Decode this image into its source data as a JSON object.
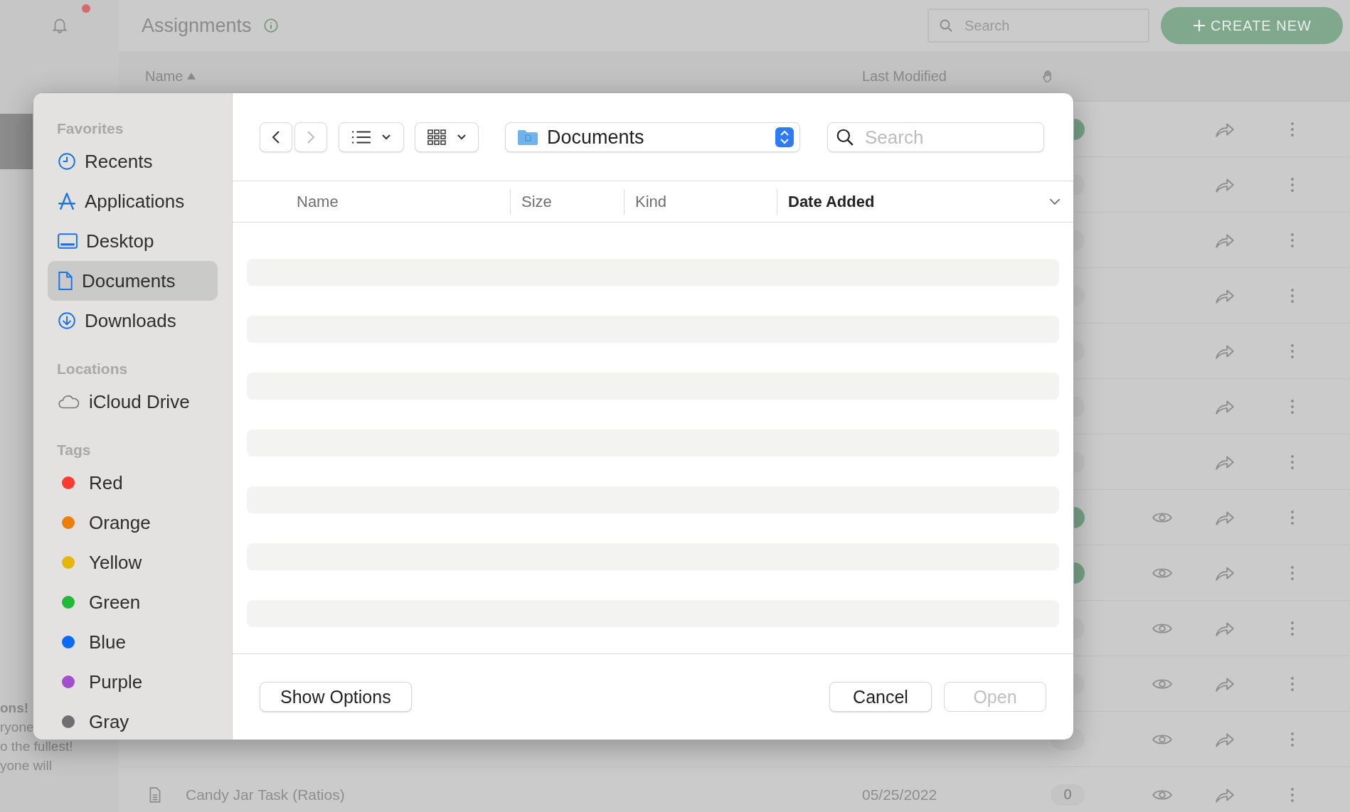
{
  "app": {
    "title": "Assignments",
    "search": {
      "placeholder": "Search"
    },
    "create_button": "CREATE NEW",
    "rail_text": [
      {
        "text": "ons!",
        "bold": true
      },
      {
        "text": "ryone",
        "bold": false
      },
      {
        "text": "o the fullest!",
        "bold": false
      },
      {
        "text": "yone will",
        "bold": false
      }
    ],
    "columns": [
      {
        "label": "Name",
        "sorted": true
      },
      {
        "label": "Last Modified",
        "sorted": false
      }
    ],
    "rows": [
      {
        "color": "#78a287",
        "viewable": false
      },
      {
        "color": "#c4c4c4",
        "viewable": false
      },
      {
        "color": "#c4c4c4",
        "viewable": false
      },
      {
        "color": "#c4c4c4",
        "viewable": false
      },
      {
        "color": "#c4c4c4",
        "viewable": false
      },
      {
        "color": "#c4c4c4",
        "viewable": false
      },
      {
        "color": "#c4c4c4",
        "viewable": false
      },
      {
        "color": "#78a287",
        "viewable": true
      },
      {
        "color": "#78a287",
        "viewable": true
      },
      {
        "color": "#c4c4c4",
        "viewable": true
      },
      {
        "color": "#c4c4c4",
        "viewable": true
      },
      {
        "color": "#c4c4c4",
        "viewable": true
      },
      {
        "color": "#c4c4c4",
        "viewable": true,
        "name": "Candy Jar Task (Ratios)",
        "date": "05/25/2022",
        "count": "0"
      }
    ]
  },
  "dialog": {
    "sidebar": [
      {
        "heading": "Favorites",
        "items": [
          {
            "label": "Recents",
            "selected": false
          },
          {
            "label": "Applications",
            "selected": false
          },
          {
            "label": "Desktop",
            "selected": false
          },
          {
            "label": "Documents",
            "selected": true
          },
          {
            "label": "Downloads",
            "selected": false
          }
        ]
      },
      {
        "heading": "Locations",
        "items": [
          {
            "label": "iCloud Drive",
            "selected": false
          }
        ]
      },
      {
        "heading": "Tags",
        "items": [
          {
            "label": "Red",
            "color": "#fe3b30"
          },
          {
            "label": "Orange",
            "color": "#ec7f0c"
          },
          {
            "label": "Yellow",
            "color": "#e7b60a"
          },
          {
            "label": "Green",
            "color": "#21b93a"
          },
          {
            "label": "Blue",
            "color": "#0a6bf7"
          },
          {
            "label": "Purple",
            "color": "#a24fcd"
          },
          {
            "label": "Gray",
            "color": "#6f6e73"
          }
        ]
      }
    ],
    "back_disabled": false,
    "forward_disabled": true,
    "location": "Documents",
    "search": {
      "placeholder": "Search"
    },
    "columns": [
      {
        "label": "Name",
        "sorted": false
      },
      {
        "label": "Size",
        "sorted": false
      },
      {
        "label": "Kind",
        "sorted": false
      },
      {
        "label": "Date Added",
        "sorted": true
      }
    ],
    "buttons": [
      {
        "label": "Show Options",
        "disabled": false
      },
      {
        "label": "Cancel",
        "disabled": false
      },
      {
        "label": "Open",
        "disabled": true
      }
    ]
  }
}
